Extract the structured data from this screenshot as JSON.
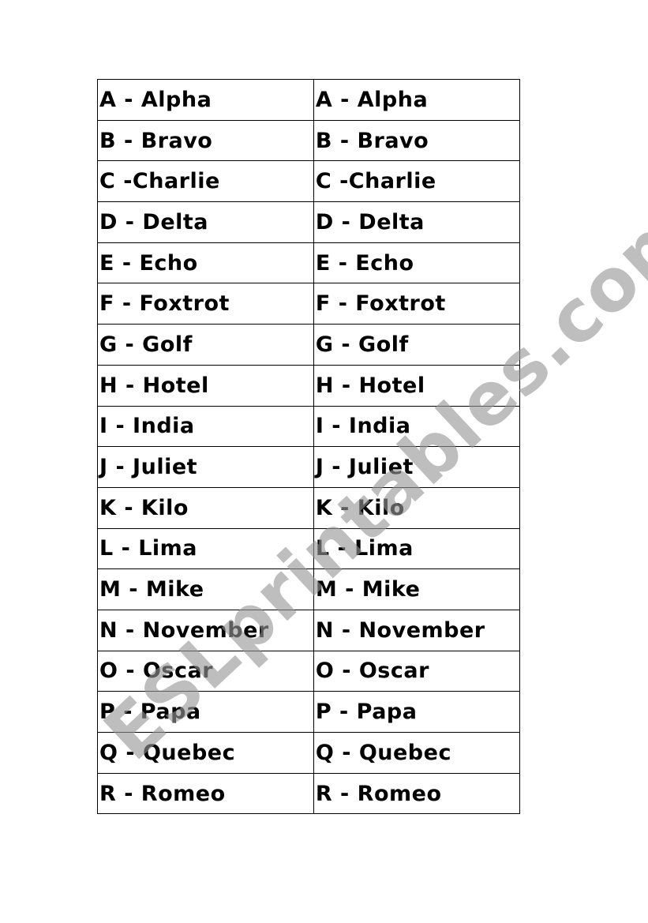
{
  "document": {
    "type": "worksheet",
    "table": {
      "rows": [
        [
          "A - Alpha",
          "A - Alpha"
        ],
        [
          "B - Bravo",
          "B - Bravo"
        ],
        [
          "C -Charlie",
          "C -Charlie"
        ],
        [
          "D - Delta",
          "D - Delta"
        ],
        [
          "E - Echo",
          "E - Echo"
        ],
        [
          "F - Foxtrot",
          "F - Foxtrot"
        ],
        [
          "G - Golf",
          "G - Golf"
        ],
        [
          "H - Hotel",
          "H - Hotel"
        ],
        [
          "I - India",
          "I - India"
        ],
        [
          "J - Juliet",
          "J - Juliet"
        ],
        [
          "K - Kilo",
          "K - Kilo"
        ],
        [
          "L - Lima",
          "L - Lima"
        ],
        [
          "M - Mike",
          "M - Mike"
        ],
        [
          "N - November",
          "N - November"
        ],
        [
          "O - Oscar",
          "O - Oscar"
        ],
        [
          "P - Papa",
          "P - Papa"
        ],
        [
          "Q - Quebec",
          "Q - Quebec"
        ],
        [
          "R - Romeo",
          "R - Romeo"
        ]
      ]
    },
    "watermark": {
      "text": "ESLprintables.com",
      "color": "#969696"
    }
  }
}
